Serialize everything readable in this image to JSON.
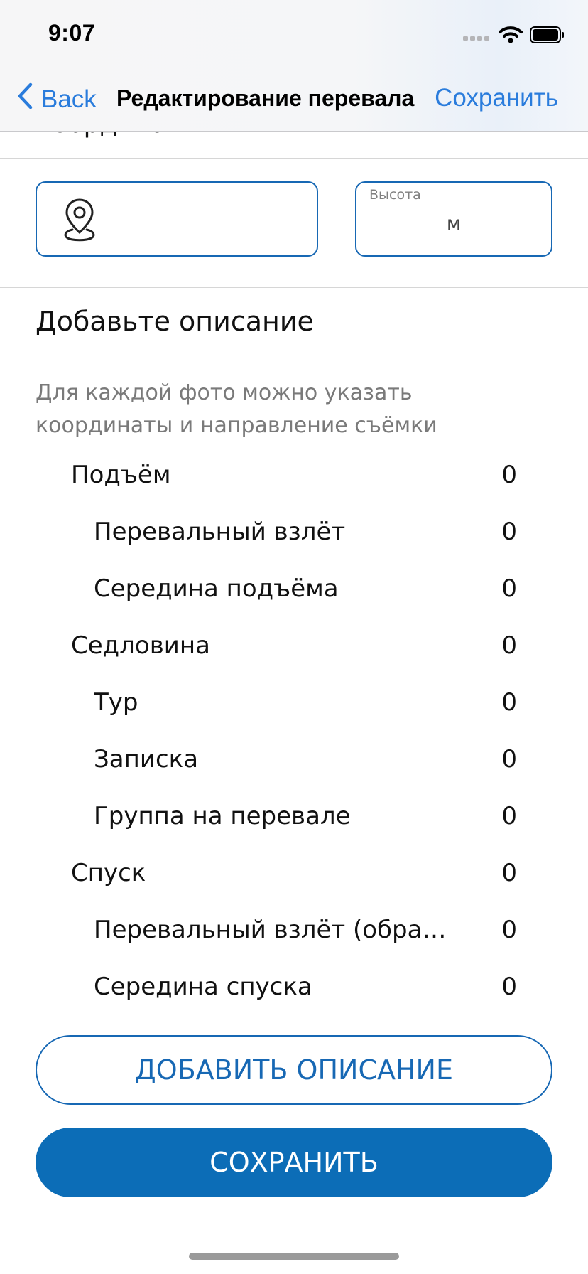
{
  "status_bar": {
    "time": "9:07",
    "icons": [
      "cellular-signal-icon",
      "wifi-icon",
      "battery-icon"
    ]
  },
  "nav": {
    "back_label": "Back",
    "title": "Редактирование перевала",
    "save_label": "Сохранить"
  },
  "partial_section_title": "Координаты",
  "coordinates": {
    "icon": "map-pin-icon",
    "value": ""
  },
  "height": {
    "label": "Высота",
    "unit": "м",
    "value": ""
  },
  "description": {
    "title": "Добавьте описание",
    "hint": "Для каждой фото можно указать координаты и направление съёмки"
  },
  "photo_categories": [
    {
      "label": "Подъём",
      "count": "0",
      "level": 1
    },
    {
      "label": "Перевальный взлёт",
      "count": "0",
      "level": 2
    },
    {
      "label": "Середина подъёма",
      "count": "0",
      "level": 2
    },
    {
      "label": "Седловина",
      "count": "0",
      "level": 1
    },
    {
      "label": "Тур",
      "count": "0",
      "level": 2
    },
    {
      "label": "Записка",
      "count": "0",
      "level": 2
    },
    {
      "label": "Группа на перевале",
      "count": "0",
      "level": 2
    },
    {
      "label": "Спуск",
      "count": "0",
      "level": 1
    },
    {
      "label": "Перевальный взлёт (обрат...",
      "count": "0",
      "level": 2
    },
    {
      "label": "Середина спуска",
      "count": "0",
      "level": 2
    }
  ],
  "buttons": {
    "add_description": "ДОБАВИТЬ ОПИСАНИЕ",
    "save": "СОХРАНИТЬ"
  },
  "colors": {
    "accent": "#1768b4",
    "primary_button": "#0c6db7",
    "nav_link": "#2a7cdc",
    "hint_text": "#7a7a7a"
  }
}
